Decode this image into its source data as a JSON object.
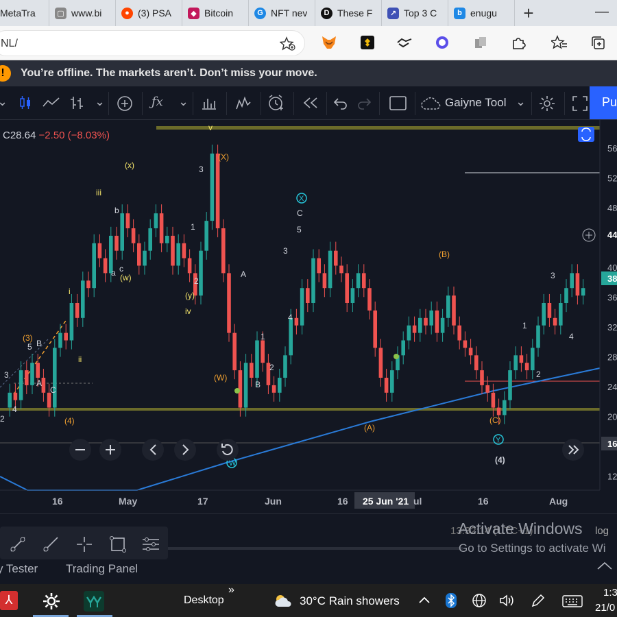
{
  "browser": {
    "tabs": [
      {
        "title": "MetaTra",
        "color": "#555"
      },
      {
        "title": "www.bi",
        "color": "#777"
      },
      {
        "title": "(3) PSA",
        "color": "#ff4500"
      },
      {
        "title": "Bitcoin",
        "color": "#c2185b"
      },
      {
        "title": "NFT nev",
        "color": "#1e88e5"
      },
      {
        "title": "These F",
        "color": "#111"
      },
      {
        "title": "Top 3 C",
        "color": "#3f51b5"
      },
      {
        "title": "enugu",
        "color": "#1e88e5"
      }
    ],
    "new_tab": "+",
    "url": "NL/"
  },
  "banner": {
    "icon": "!",
    "message": "You’re offline. The markets aren’t. Don’t miss your move."
  },
  "toolbar": {
    "tool_name": "Gaiyne Tool",
    "publish": "Pu"
  },
  "chart": {
    "ohlc_close": "C28.64",
    "ohlc_change": "−2.50 (−8.03%)",
    "date_tooltip": "25 Jun '21",
    "price_badge_1": "44",
    "price_badge_2": "38",
    "price_badge_3": "16"
  },
  "chart_data": {
    "type": "line",
    "x_labels": [
      "16",
      "May",
      "17",
      "Jun",
      "16",
      "25 Jun '21",
      "ul",
      "16",
      "Aug"
    ],
    "y_labels": [
      "56",
      "52",
      "48",
      "44",
      "40",
      "36",
      "32",
      "28",
      "24",
      "20",
      "16",
      "12"
    ],
    "annotations": [
      "(x)",
      "iii",
      "b",
      "a",
      "c",
      "(w)",
      "i",
      "ii",
      "(3)",
      "5",
      "B",
      "A",
      "C",
      "3",
      "2",
      "4",
      "(4)",
      "v",
      "(X)",
      "3",
      "1",
      "2",
      "(y)",
      "iv",
      "A",
      "1",
      "2",
      "B",
      "(W)",
      "X",
      "C",
      "5",
      "3",
      "4",
      "(B)",
      "(A)",
      "(C)",
      "Y",
      "(4)",
      "1",
      "2",
      "3",
      "4",
      "W"
    ]
  },
  "bottom": {
    "tabs": [
      "y Tester",
      "Trading Panel"
    ],
    "status_text": "13:32:14 (UTC+1)",
    "status_log": "log",
    "activate_title": "Activate Windows",
    "activate_sub": "Go to Settings to activate Wi"
  },
  "taskbar": {
    "desktop": "Desktop",
    "weather": "30°C  Rain showers",
    "time": "1:3",
    "date": "21/0"
  }
}
